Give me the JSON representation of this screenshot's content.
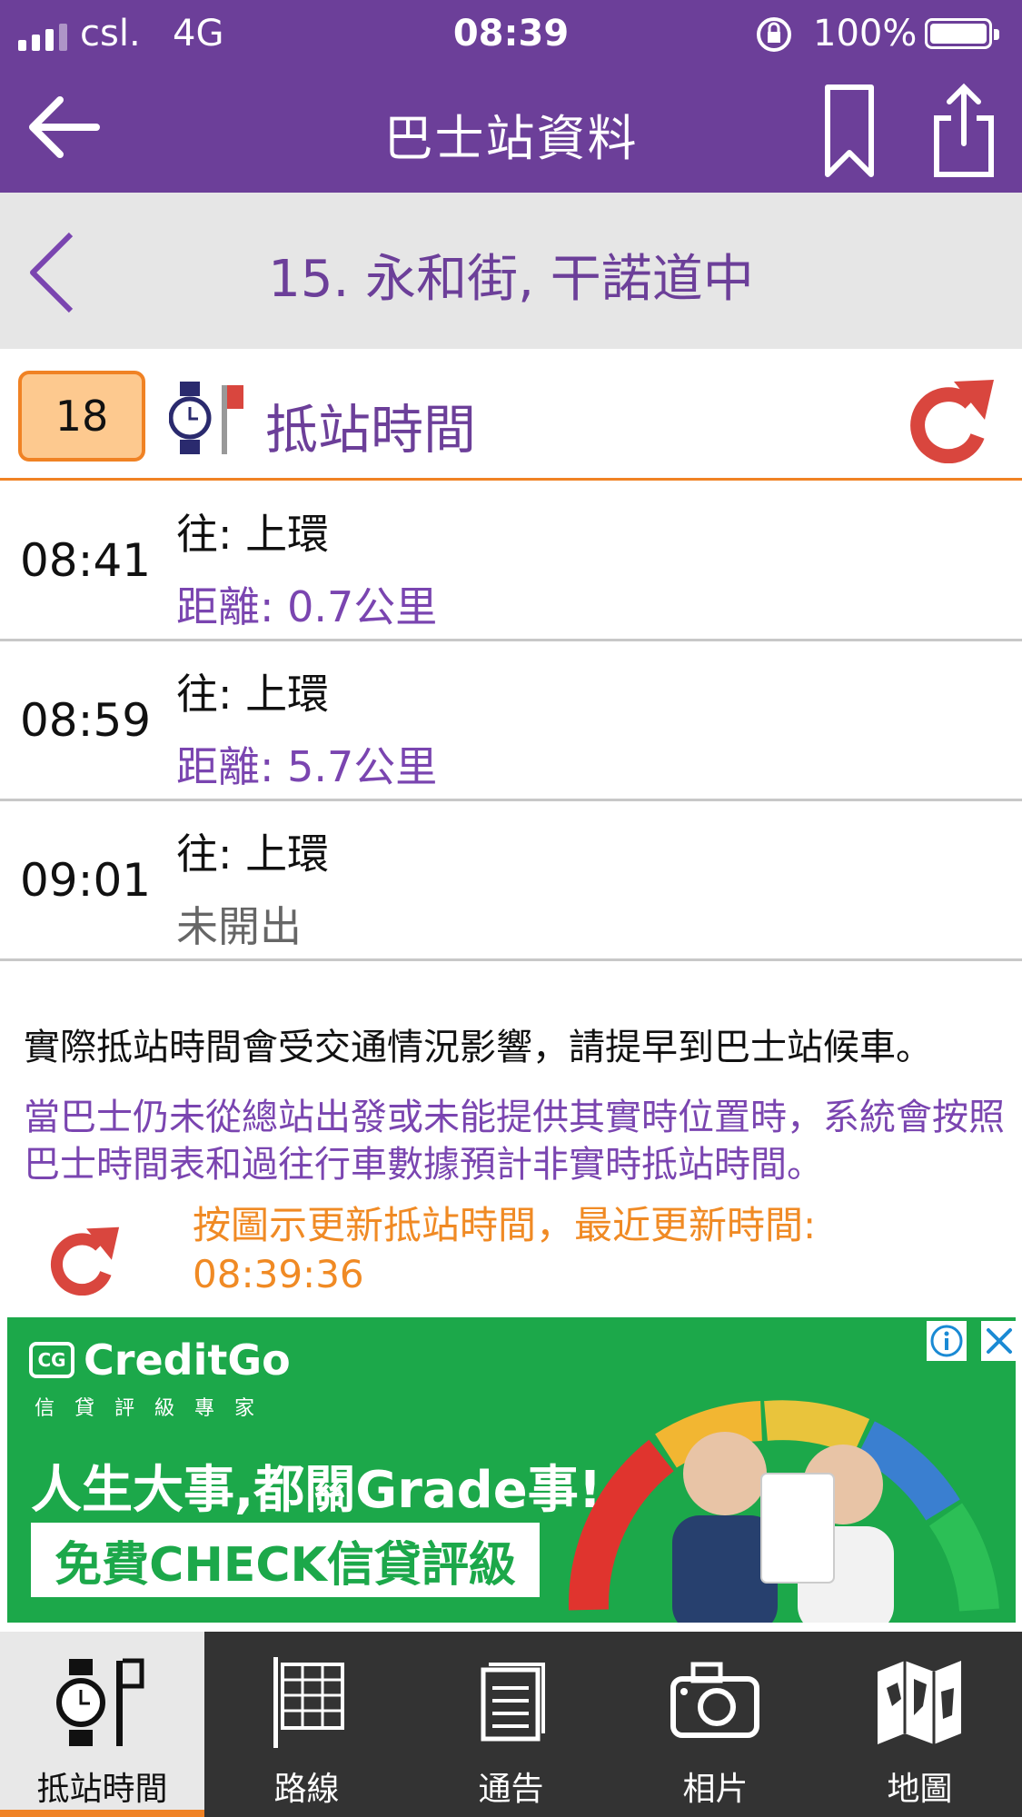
{
  "status_bar": {
    "carrier": "csl.",
    "network": "4G",
    "time": "08:39",
    "battery": "100%"
  },
  "header": {
    "title": "巴士站資料",
    "back_icon": "arrow-left-icon",
    "bookmark_icon": "bookmark-icon",
    "share_icon": "share-icon"
  },
  "stop": {
    "name": "15. 永和街, 干諾道中"
  },
  "route": {
    "number": "18",
    "heading": "抵站時間"
  },
  "etas": [
    {
      "time": "08:41",
      "destination": "往: 上環",
      "detail": "距離: 0.7公里"
    },
    {
      "time": "08:59",
      "destination": "往: 上環",
      "detail": "距離: 5.7公里"
    },
    {
      "time": "09:01",
      "destination": "往: 上環",
      "detail": "未開出"
    }
  ],
  "notes": {
    "traffic": "實際抵站時間會受交通情況影響，請提早到巴士站候車。",
    "estimate": "當巴士仍未從總站出發或未能提供其實時位置時，系統會按照巴士時間表和過往行車數據預計非實時抵站時間。",
    "update_prefix": "按圖示更新抵站時間，最近更新時間:",
    "update_time": "08:39:36"
  },
  "ad": {
    "brand": "CreditGo",
    "brand_sub": "信貸評級專家",
    "headline": "人生大事,都關Grade事!",
    "cta": "免費CHECK信貸評級"
  },
  "tabs": [
    {
      "label": "抵站時間",
      "icon": "clock-stop-icon",
      "active": true
    },
    {
      "label": "路線",
      "icon": "route-grid-icon",
      "active": false
    },
    {
      "label": "通告",
      "icon": "notice-icon",
      "active": false
    },
    {
      "label": "相片",
      "icon": "camera-icon",
      "active": false
    },
    {
      "label": "地圖",
      "icon": "map-icon",
      "active": false
    }
  ],
  "colors": {
    "brand_purple": "#6c3f99",
    "accent_orange": "#f08224",
    "refresh_red": "#d9463e",
    "ad_green": "#1ca84a"
  }
}
